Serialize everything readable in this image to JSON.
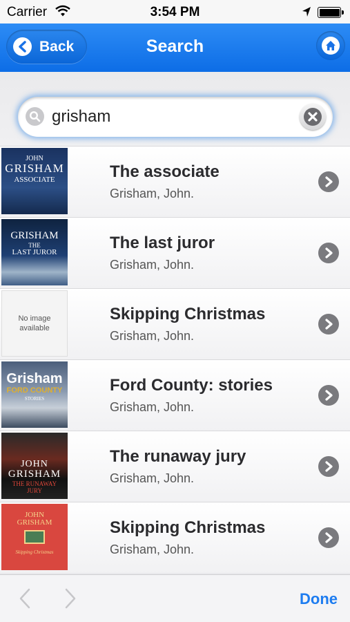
{
  "status_bar": {
    "carrier": "Carrier",
    "time": "3:54 PM"
  },
  "nav": {
    "back_label": "Back",
    "title": "Search"
  },
  "search": {
    "value": "grisham"
  },
  "results": [
    {
      "title": "The associate",
      "author": "Grisham, John.",
      "cover": {
        "line1": "JOHN",
        "line2": "GRISHAM",
        "line3": "ASSOCIATE"
      }
    },
    {
      "title": "The last juror",
      "author": "Grisham, John.",
      "cover": {
        "line1": "GRISHAM",
        "line2": "THE",
        "line3": "LAST JUROR"
      }
    },
    {
      "title": "Skipping Christmas",
      "author": "Grisham, John.",
      "cover": {
        "line1": "No image",
        "line2": "available"
      }
    },
    {
      "title": "Ford County: stories",
      "author": "Grisham, John.",
      "cover": {
        "line1": "Grisham",
        "line2": "FORD COUNTY",
        "line3": "STORIES"
      }
    },
    {
      "title": "The runaway jury",
      "author": "Grisham, John.",
      "cover": {
        "line1": "JOHN",
        "line2": "GRISHAM",
        "line3": "THE RUNAWAY",
        "line4": "JURY"
      }
    },
    {
      "title": "Skipping Christmas",
      "author": "Grisham, John.",
      "cover": {
        "line1": "JOHN",
        "line2": "GRISHAM",
        "line3": "Skipping Christmas"
      }
    }
  ],
  "toolbar": {
    "done_label": "Done"
  }
}
